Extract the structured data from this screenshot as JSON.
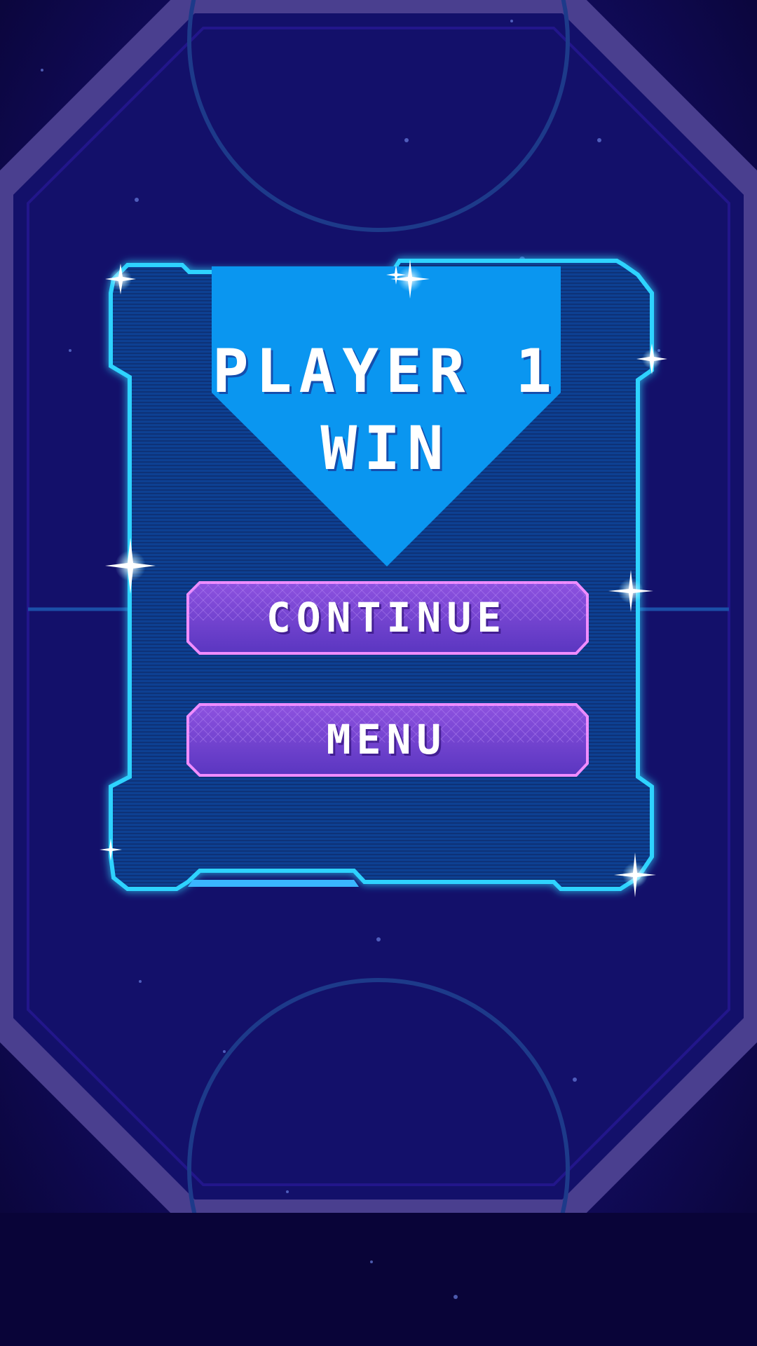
{
  "screen": "win-dialog",
  "result": {
    "line1": "PLAYER 1",
    "line2": "WIN"
  },
  "buttons": {
    "continue_label": "CONTINUE",
    "menu_label": "MENU"
  },
  "colors": {
    "background": "#0a0538",
    "rink_border": "#4a3f8f",
    "panel_fill": "#0e3d8f",
    "panel_glow": "#2fd3ff",
    "banner": "#0a96f0",
    "button_fill": "#6a3fc8",
    "button_border": "#f08cff"
  }
}
